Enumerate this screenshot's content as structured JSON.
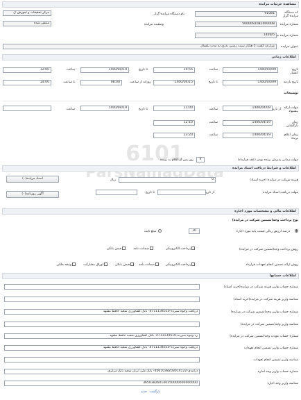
{
  "header": {
    "title": "مشاهده جزئیات مزایده"
  },
  "general": {
    "auctioneer_code_label": "کد دستگاه مزایده گزار",
    "auctioneer_code": "91081",
    "auctioneer_name_label": "نام دستگاه مزایده گزار",
    "auctioneer_name": "مرکز تحقیقات و آموزش ک",
    "auction_number_label": "شماره مزایده",
    "auction_number": "5000091081000008",
    "status_label": "وضعیت مزایده",
    "status_value": "منتشر شده",
    "ref_number_label": "شماره مزایده مرجع",
    "ref_number": "1400/5",
    "title_label": "عنوان مزایده",
    "title_value": "مزارعه کشت 5 هکتار سیب زمینی بذری-به مدت یکسال"
  },
  "timing": {
    "section_title": "اطلاعات زمانی",
    "publish_date_label": "تاریخ انتشار",
    "publish_date": "1400/04/09",
    "time_label": "ساعت",
    "publish_time": "10:55",
    "to_date_label": "تا تاریخ",
    "publish_to_date": "1400/04/19",
    "publish_to_time": "12:00",
    "visit_date_label": "تاریخ بازدید",
    "visit_date": "1400/04/09",
    "visit_to_date": "1400/04/15",
    "daily_from_label": "روزانه از ساعت",
    "visit_from_time": "08:00",
    "to_time_label": "تا ساعت",
    "visit_to_time": "14:00"
  },
  "notes": {
    "section_title": "توضیحات"
  },
  "offers": {
    "offer_label": "مهلت ارائه پیشنهاد",
    "from_label": "از تاریخ",
    "offer_from_date": "1400/04/09",
    "offer_from_time": "11:00",
    "offer_to_date": "1400/04/19",
    "offer_to_time": "",
    "opening_label": "زمان بازگشایی",
    "opening_date": "1400/04/19",
    "opening_time": "12:10",
    "winner_label": "زمان اعلام برنده",
    "winner_date": "1400/04/19",
    "winner_time": "13:20"
  },
  "contract": {
    "deadline_label": "مهلت زمانی پذیرش برنده بودن (عقد قرارداد)",
    "deadline_value": "4",
    "deadline_suffix": "روز پس از اعلام به برنده"
  },
  "documents": {
    "section_title": "اطلاعات و شرایط دریافت اسناد مزایده",
    "doc_fee_label": "هزینه شرکت در مزایده (خرید اسناد)",
    "doc_fee_value": "0",
    "currency_label": "ریال",
    "auction_docs_button": "اسناد مزایده(۰)",
    "doc_receive_label": "مهلت دریافت اسناد مزایده",
    "newspaper_button": "آگهی روزنامه(۰)"
  },
  "financial": {
    "section_title": "اطلاعات مالی و مشخصات مورد اجاره",
    "guarantee_type_label": "نوع پرداخت وجه(تضمین شرکت در مزایده)",
    "percent_value": "10",
    "percent_text": "درصد ارزش ریالی قیمت پایه مورد اجاره",
    "fixed_amount_label": "مبلغ ثابت",
    "pay_method_label": "روش پرداخت وجه(تضمین شرکت در مزایده)",
    "pay_opt_electronic": "پرداخت الکترونیکی",
    "pay_opt_guarantee": "ضمانت نامه",
    "pay_opt_bank": "فیش بانکی",
    "contract_guarantee_label": "روش ارائه تضمین انجام تعهدات قرارداد",
    "cg_opt_electronic": "پرداخت الکترونیکی",
    "cg_opt_guarantee": "ضمانت نامه",
    "cg_opt_bank": "فیش بانکی",
    "cg_opt_bonds": "اوراق مشارکت",
    "cg_opt_property": "وثیقه ملکی"
  },
  "accounts": {
    "section_title": "اطلاعات حسابها",
    "rows": [
      {
        "label": "شماره حساب واریز هزینه شرکت در مزایده(خرید اسناد)",
        "value": ""
      },
      {
        "label": "شناسه واریز هزینه شرکت در مزایده(خرید اسناد)",
        "value": ""
      },
      {
        "label": "شماره حساب واریز وجه(تضمین شرکت در مزایده)",
        "value": "دریافت وجوه سپرده-4711134510- بانک کشاورزی شعبه حافظ مشهد"
      },
      {
        "label": "شناسه واریز وجه(تضمین شرکت در مزایده)",
        "value": ""
      },
      {
        "label": "شماره حساب مودت وجه(تضمین شرکت در مزایده)",
        "value": "رد وجوه سپرده-4711134510- بانک کشاورزی شعبه حافظ مشهد"
      },
      {
        "label": "شماره حساب واریز تضمین انجام تعهدات",
        "value": "دریافت وجوه سپرده-4711134510- بانک کشاورزی شعبه حافظ مشهد"
      },
      {
        "label": "شناسه واریز تضمین انجام تعهدات",
        "value": ""
      },
      {
        "label": "شماره حساب واریز وجه اجاره",
        "value": "درآمدی-4001038203014122- بانک ملی ایران شعبه بانک مرکزی"
      },
      {
        "label": "شناسه واریز وجه اجاره",
        "value": "365038260140150000000000000"
      }
    ]
  },
  "watermark": {
    "number": "6101",
    "brand": "ParsNamadData"
  },
  "footer": {
    "back_link": "بازگشت",
    "top_link": "جدید"
  }
}
